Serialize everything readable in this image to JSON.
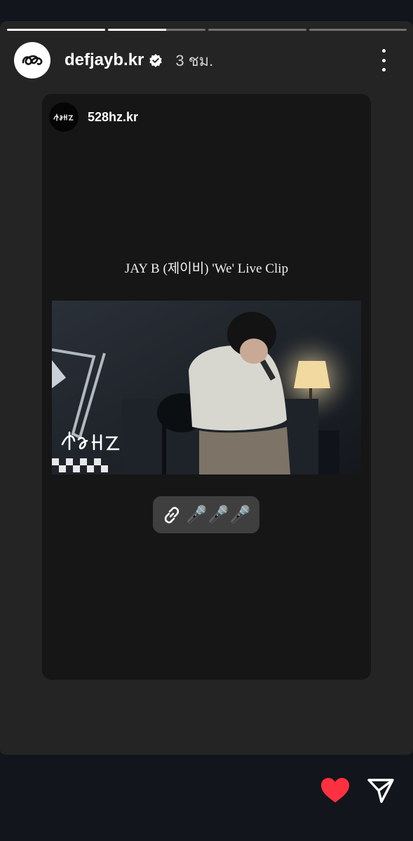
{
  "story": {
    "progress": [
      1.0,
      0.6,
      0.0,
      0.0
    ],
    "username": "defjayb.kr",
    "time": "3 ชม.",
    "avatar_icon": "brand-logo-icon",
    "verified_icon": "verified-badge-icon",
    "more_icon": "more-vertical-icon"
  },
  "shared_post": {
    "username": "528hz.kr",
    "avatar_icon": "528hz-logo-icon",
    "title": "JAY B (제이비) 'We' Live Clip",
    "thumbnail_icon": "video-thumbnail-image",
    "link_sticker": {
      "icon": "link-icon",
      "text": "🎤🎤🎤"
    }
  },
  "actions": {
    "like_icon": "heart-icon",
    "share_icon": "send-icon",
    "like_color": "#ff3040"
  }
}
